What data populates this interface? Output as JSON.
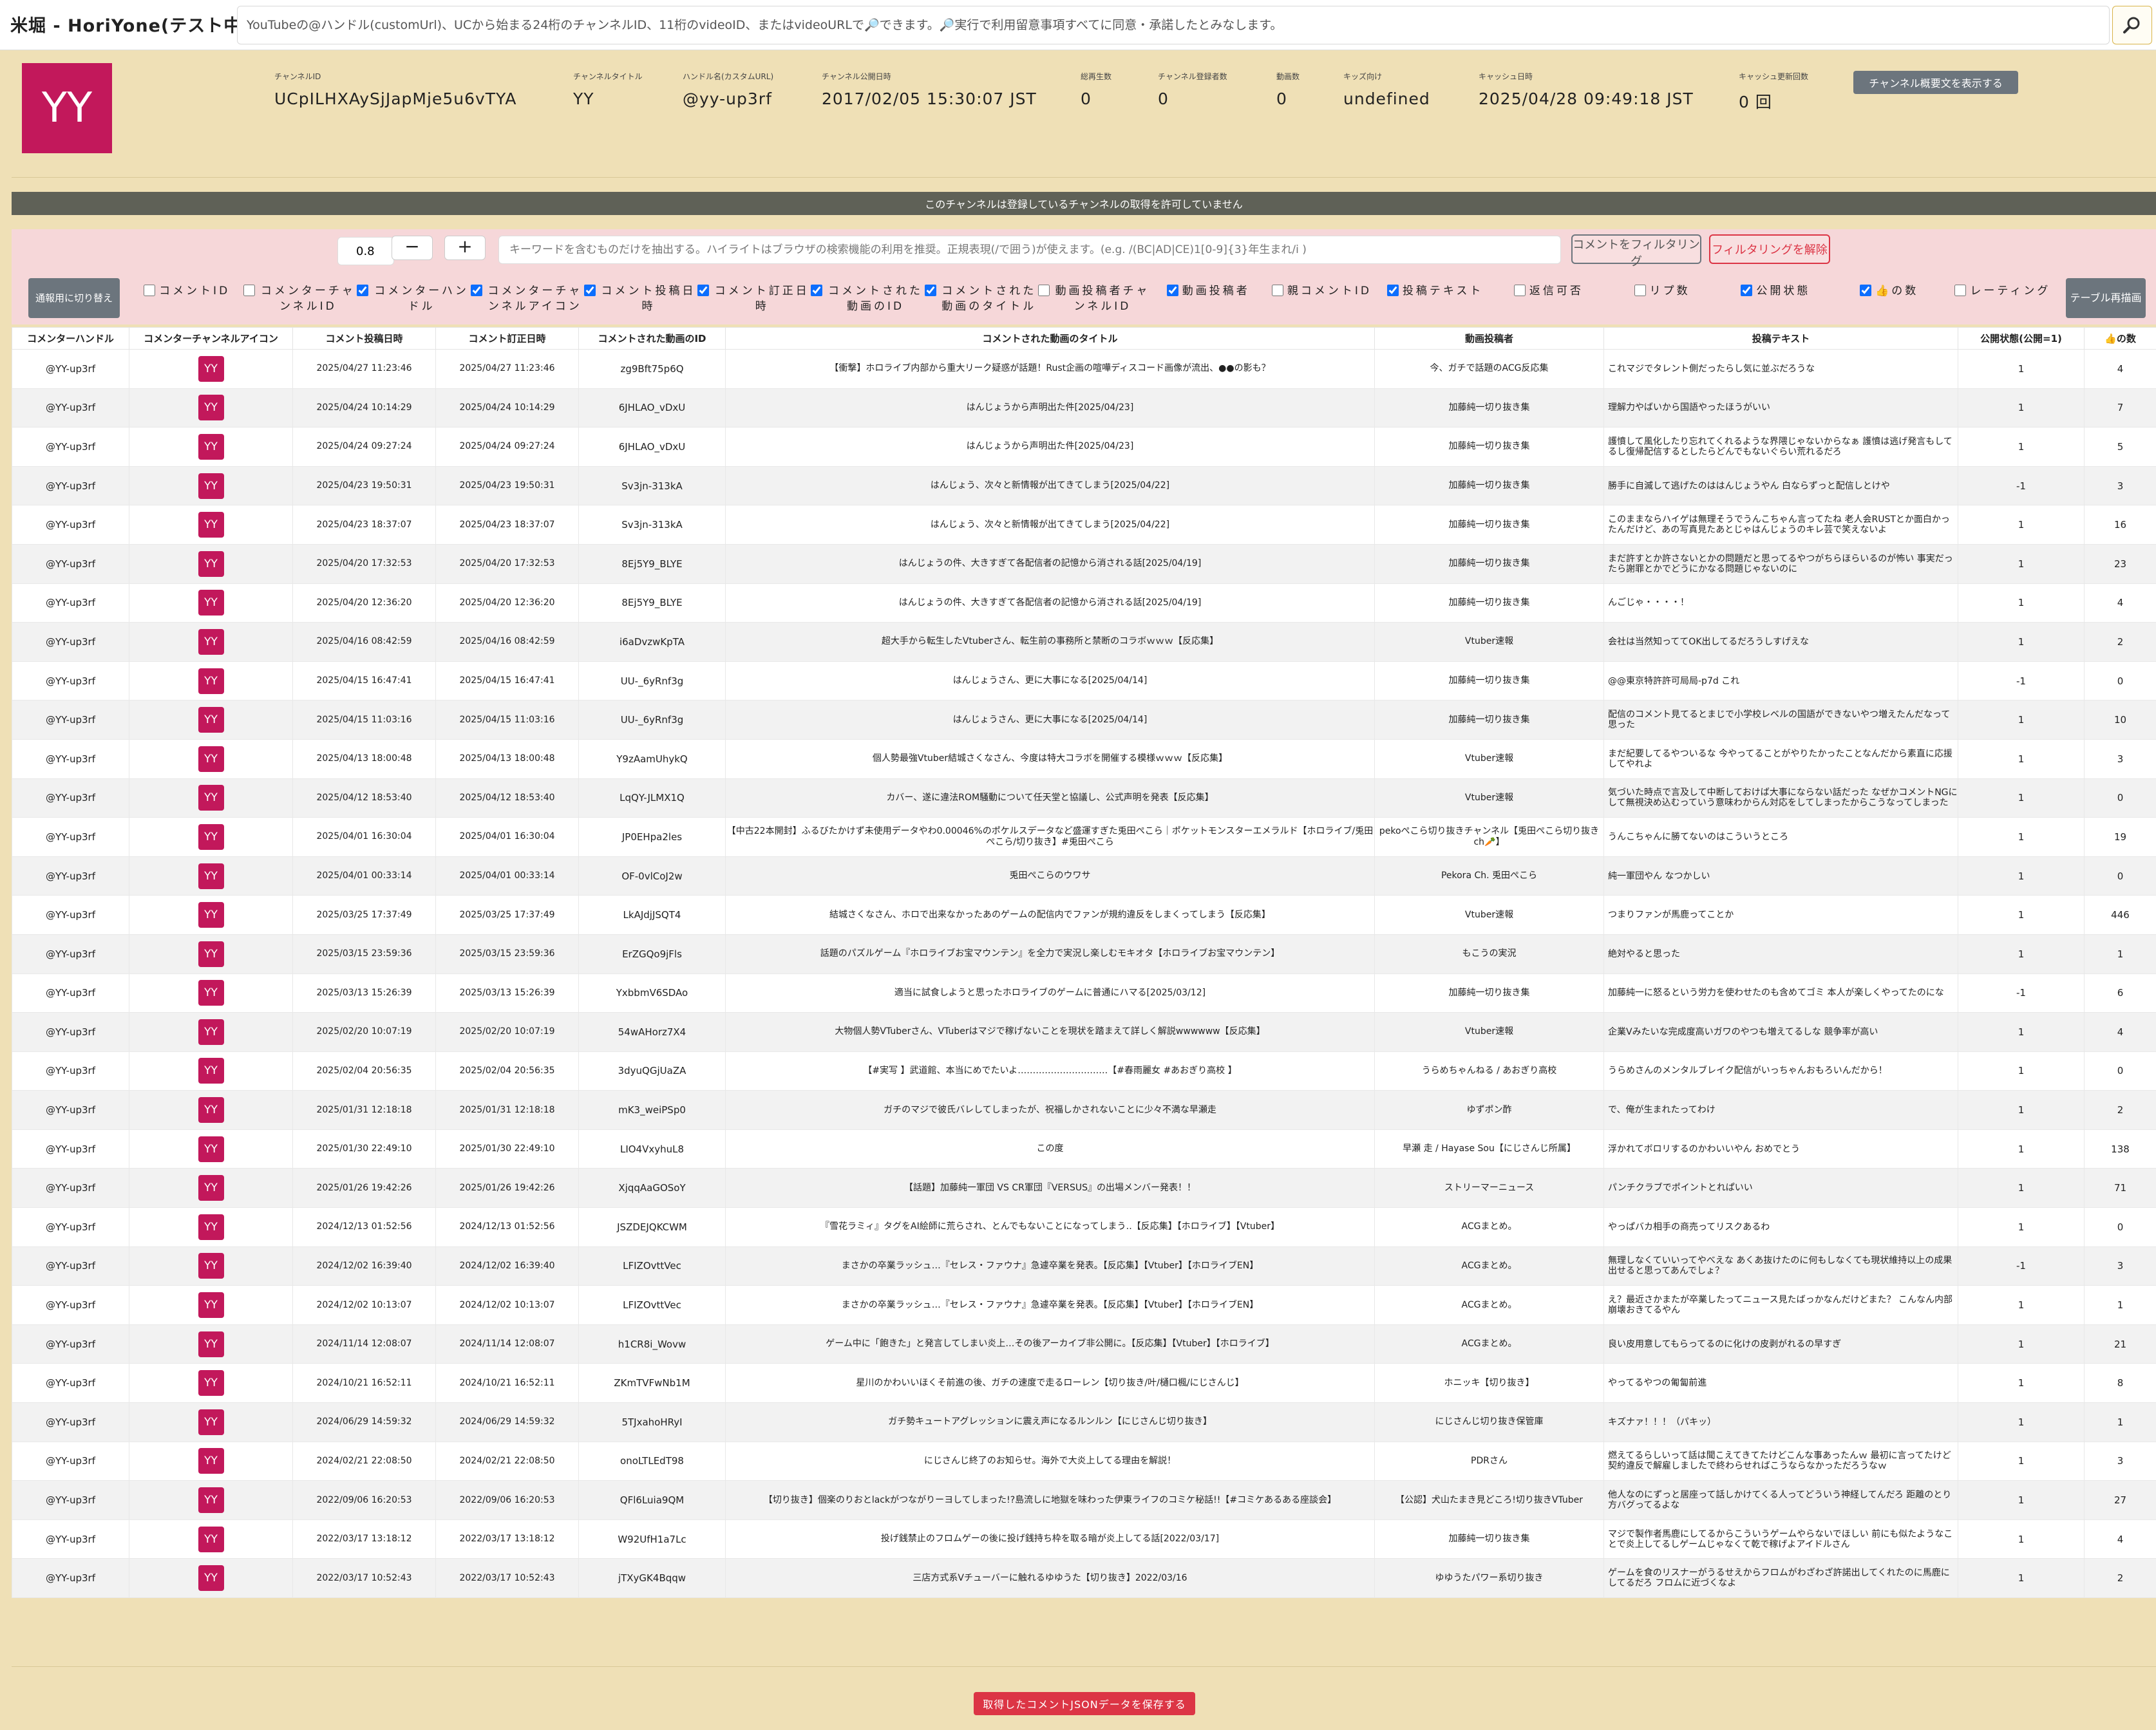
{
  "app": {
    "title": "米堀 - HoriYone(テスト中)"
  },
  "search": {
    "placeholder": "YouTubeの@ハンドル(customUrl)、UCから始まる24桁のチャンネルID、11桁のvideoID、またはvideoURLで🔎できます。🔎実行で利用留意事項すべてに同意・承諾したとみなします。",
    "button_icon": "search-icon"
  },
  "channel": {
    "avatar_text": "YY",
    "avatar_color": "#c2185b",
    "fields": [
      {
        "label": "チャンネルID",
        "value": "UCpILHXAySjJapMje5u6vTYA"
      },
      {
        "label": "チャンネルタイトル",
        "value": "YY"
      },
      {
        "label": "ハンドル名(カスタムURL)",
        "value": "@yy-up3rf"
      },
      {
        "label": "チャンネル公開日時",
        "value": "2017/02/05 15:30:07 JST"
      },
      {
        "label": "総再生数",
        "value": "0"
      },
      {
        "label": "チャンネル登録者数",
        "value": "0"
      },
      {
        "label": "動画数",
        "value": "0"
      },
      {
        "label": "キッズ向け",
        "value": "undefined"
      },
      {
        "label": "キャッシュ日時",
        "value": "2025/04/28 09:49:18 JST"
      },
      {
        "label": "キャッシュ更新回数",
        "value": "0 回"
      }
    ],
    "desc_button": "チャンネル概要文を表示する"
  },
  "notice": "このチャンネルは登録しているチャンネルの取得を許可していません",
  "filter": {
    "threshold": "0.8",
    "minus": "−",
    "plus": "+",
    "keyword_placeholder": "キーワードを含むものだけを抽出する。ハイライトはブラウザの検索機能の利用を推奨。正規表現(/で囲う)が使えます。(e.g. /(BC|AD|CE)1[0-9]{3}年生まれ/i )",
    "apply_button": "コメントをフィルタリング",
    "clear_button": "フィルタリングを解除",
    "mobile_button": "通報用に切り替え",
    "redraw_button": "テーブル再描画"
  },
  "columns": [
    {
      "label": "コメントID",
      "checked": false
    },
    {
      "label": "コメンターチャンネルID",
      "checked": false
    },
    {
      "label": "コメンターハンドル",
      "checked": true
    },
    {
      "label": "コメンターチャンネルアイコン",
      "checked": true
    },
    {
      "label": "コメント投稿日時",
      "checked": true
    },
    {
      "label": "コメント訂正日時",
      "checked": true
    },
    {
      "label": "コメントされた動画のID",
      "checked": true
    },
    {
      "label": "コメントされた動画のタイトル",
      "checked": true
    },
    {
      "label": "動画投稿者チャンネルID",
      "checked": false
    },
    {
      "label": "動画投稿者",
      "checked": true
    },
    {
      "label": "親コメントID",
      "checked": false
    },
    {
      "label": "投稿テキスト",
      "checked": true
    },
    {
      "label": "返信可否",
      "checked": false
    },
    {
      "label": "リプ数",
      "checked": false
    },
    {
      "label": "公開状態",
      "checked": true
    },
    {
      "label": "👍の数",
      "checked": true
    },
    {
      "label": "レーティング",
      "checked": false
    }
  ],
  "table": {
    "headers": [
      "コメンターハンドル",
      "コメンターチャンネルアイコン",
      "コメント投稿日時",
      "コメント訂正日時",
      "コメントされた動画のID",
      "コメントされた動画のタイトル",
      "動画投稿者",
      "投稿テキスト",
      "公開状態(公開=1)",
      "👍の数"
    ],
    "icon_text": "YY",
    "rows": [
      [
        "@YY-up3rf",
        "2025/04/27 11:23:46",
        "2025/04/27 11:23:46",
        "zg9Bft75p6Q",
        "【衝撃】ホロライブ内部から重大リーク疑惑が話題！Rust企画の喧嘩ディスコード画像が流出、●●の影も？",
        "今、ガチで話題のACG反応集",
        "これマジでタレント側だったらし気に並ぶだろうな",
        "1",
        "4"
      ],
      [
        "@YY-up3rf",
        "2025/04/24 10:14:29",
        "2025/04/24 10:14:29",
        "6JHLAO_vDxU",
        "はんじょうから声明出た件[2025/04/23]",
        "加藤純一切り抜き集",
        "理解力やばいから国語やったほうがいい",
        "1",
        "7"
      ],
      [
        "@YY-up3rf",
        "2025/04/24 09:27:24",
        "2025/04/24 09:27:24",
        "6JHLAO_vDxU",
        "はんじょうから声明出た件[2025/04/23]",
        "加藤純一切り抜き集",
        "護憤して風化したり忘れてくれるような界隈じゃないからなぁ 護憤は逃げ発言もしてるし復帰配信するとしたらどんでもないぐらい荒れるだろ",
        "1",
        "5"
      ],
      [
        "@YY-up3rf",
        "2025/04/23 19:50:31",
        "2025/04/23 19:50:31",
        "Sv3jn-313kA",
        "はんじょう、次々と新情報が出てきてしまう[2025/04/22]",
        "加藤純一切り抜き集",
        "勝手に自滅して逃げたのははんじょうやん 白ならずっと配信しとけや",
        "-1",
        "3"
      ],
      [
        "@YY-up3rf",
        "2025/04/23 18:37:07",
        "2025/04/23 18:37:07",
        "Sv3jn-313kA",
        "はんじょう、次々と新情報が出てきてしまう[2025/04/22]",
        "加藤純一切り抜き集",
        "このままならハイゲは無理そうでうんこちゃん言ってたね 老人会RUSTとか面白かったんだけど、あの写真見たあとじゃはんじょうのキレ芸で笑えないよ",
        "1",
        "16"
      ],
      [
        "@YY-up3rf",
        "2025/04/20 17:32:53",
        "2025/04/20 17:32:53",
        "8Ej5Y9_BLYE",
        "はんじょうの件、大きすぎて各配信者の記憶から消される話[2025/04/19]",
        "加藤純一切り抜き集",
        "まだ許すとか許さないとかの問題だと思ってるやつがちらほらいるのが怖い 事実だったら謝罪とかでどうにかなる問題じゃないのに",
        "1",
        "23"
      ],
      [
        "@YY-up3rf",
        "2025/04/20 12:36:20",
        "2025/04/20 12:36:20",
        "8Ej5Y9_BLYE",
        "はんじょうの件、大きすぎて各配信者の記憶から消される話[2025/04/19]",
        "加藤純一切り抜き集",
        "んごじゃ・・・・！",
        "1",
        "4"
      ],
      [
        "@YY-up3rf",
        "2025/04/16 08:42:59",
        "2025/04/16 08:42:59",
        "i6aDvzwKpTA",
        "超大手から転生したVtuberさん、転生前の事務所と禁断のコラボｗｗｗ【反応集】",
        "Vtuber速報",
        "会社は当然知っててOK出してるだろうしすげえな",
        "1",
        "2"
      ],
      [
        "@YY-up3rf",
        "2025/04/15 16:47:41",
        "2025/04/15 16:47:41",
        "UU-_6yRnf3g",
        "はんじょうさん、更に大事になる[2025/04/14]",
        "加藤純一切り抜き集",
        "@@東京特許許可局局-p7d これ",
        "-1",
        "0"
      ],
      [
        "@YY-up3rf",
        "2025/04/15 11:03:16",
        "2025/04/15 11:03:16",
        "UU-_6yRnf3g",
        "はんじょうさん、更に大事になる[2025/04/14]",
        "加藤純一切り抜き集",
        "配信のコメント見てるとまじで小学校レベルの国語ができないやつ増えたんだなって思った",
        "1",
        "10"
      ],
      [
        "@YY-up3rf",
        "2025/04/13 18:00:48",
        "2025/04/13 18:00:48",
        "Y9zAamUhykQ",
        "個人勢最強Vtuber結城さくなさん、今度は特大コラボを開催する模様ｗｗｗ【反応集】",
        "Vtuber速報",
        "まだ紀要してるやついるな 今やってることがやりたかったことなんだから素直に応援してやれよ",
        "1",
        "3"
      ],
      [
        "@YY-up3rf",
        "2025/04/12 18:53:40",
        "2025/04/12 18:53:40",
        "LqQY-JLMX1Q",
        "カバー、遂に違法ROM騒動について任天堂と協議し、公式声明を発表【反応集】",
        "Vtuber速報",
        "気づいた時点で言及して中断しておけば大事にならない話だった なぜかコメントNGにして無視決め込むっていう意味わからん対応をしてしまったからこうなってしまった",
        "1",
        "0"
      ],
      [
        "@YY-up3rf",
        "2025/04/01 16:30:04",
        "2025/04/01 16:30:04",
        "JP0EHpa2les",
        "【中古22本開封】ふるびたかけず未使用データやわ0.00046%のポケルスデータなど盛運すぎた兎田ぺこら｜ポケットモンスターエメラルド【ホロライブ/兎田ぺこら/切り抜き】#兎田ぺこら",
        "pekoぺこら切り抜きチャンネル【兎田ぺこら切り抜きch🥕】",
        "うんこちゃんに勝てないのはこういうところ",
        "1",
        "19"
      ],
      [
        "@YY-up3rf",
        "2025/04/01 00:33:14",
        "2025/04/01 00:33:14",
        "OF-0vlCoJ2w",
        "兎田ぺこらのウワサ",
        "Pekora Ch. 兎田ぺこら",
        "純一軍団やん なつかしい",
        "1",
        "0"
      ],
      [
        "@YY-up3rf",
        "2025/03/25 17:37:49",
        "2025/03/25 17:37:49",
        "LkAJdjJSQT4",
        "結城さくなさん、ホロで出来なかったあのゲームの配信内でファンが規約違反をしまくってしまう【反応集】",
        "Vtuber速報",
        "つまりファンが馬鹿ってことか",
        "1",
        "446"
      ],
      [
        "@YY-up3rf",
        "2025/03/15 23:59:36",
        "2025/03/15 23:59:36",
        "ErZGQo9jFls",
        "話題のパズルゲーム『ホロライブお宝マウンテン』を全力で実況し楽しむモキオタ【ホロライブお宝マウンテン】",
        "もこうの実況",
        "絶対やると思った",
        "1",
        "1"
      ],
      [
        "@YY-up3rf",
        "2025/03/13 15:26:39",
        "2025/03/13 15:26:39",
        "YxbbmV6SDAo",
        "適当に試食しようと思ったホロライブのゲームに普通にハマる[2025/03/12]",
        "加藤純一切り抜き集",
        "加藤純一に怒るという労力を使わせたのも含めてゴミ 本人が楽しくやってたのにな",
        "-1",
        "6"
      ],
      [
        "@YY-up3rf",
        "2025/02/20 10:07:19",
        "2025/02/20 10:07:19",
        "54wAHorz7X4",
        "大物個人勢VTuberさん、VTuberはマジで稼げないことを現状を踏まえて詳しく解説wwwwww【反応集】",
        "Vtuber速報",
        "企業Vみたいな完成度高いガワのやつも増えてるしな 競争率が高い",
        "1",
        "4"
      ],
      [
        "@YY-up3rf",
        "2025/02/04 20:56:35",
        "2025/02/04 20:56:35",
        "3dyuQGjUaZA",
        "【#実写 】武道館、本当にめでたいよ…………………………【#春雨麗女 #あおぎり高校 】",
        "うらめちゃんねる / あおぎり高校",
        "うらめさんのメンタルブレイク配信がいっちゃんおもろいんだから！",
        "1",
        "0"
      ],
      [
        "@YY-up3rf",
        "2025/01/31 12:18:18",
        "2025/01/31 12:18:18",
        "mK3_weiPSp0",
        "ガチのマジで彼氏バレしてしまったが、祝福しかされないことに少々不満な早瀬走",
        "ゆずポン酢",
        "で、俺が生まれたってわけ",
        "1",
        "2"
      ],
      [
        "@YY-up3rf",
        "2025/01/30 22:49:10",
        "2025/01/30 22:49:10",
        "LIO4VxyhuL8",
        "この度",
        "早瀬 走 / Hayase Sou【にじさんじ所属】",
        "浮かれてボロリするのかわいいやん おめでとう",
        "1",
        "138"
      ],
      [
        "@YY-up3rf",
        "2025/01/26 19:42:26",
        "2025/01/26 19:42:26",
        "XjqqAaGOSoY",
        "【話題】加藤純一軍団 VS CR軍団『VERSUS』の出場メンバー発表！！",
        "ストリーマーニュース",
        "パンチクラブでポイントとれぱいい",
        "1",
        "71"
      ],
      [
        "@YY-up3rf",
        "2024/12/13 01:52:56",
        "2024/12/13 01:52:56",
        "JSZDEJQKCWM",
        "『雪花ラミィ』タグをAI絵師に荒らされ、とんでもないことになってしまう‥【反応集】【ホロライブ】【Vtuber】",
        "ACGまとめ。",
        "やっぱバカ相手の商売ってリスクあるわ",
        "1",
        "0"
      ],
      [
        "@YY-up3rf",
        "2024/12/02 16:39:40",
        "2024/12/02 16:39:40",
        "LFIZOvttVec",
        "まさかの卒業ラッシュ…『セレス・ファウナ』急遽卒業を発表。【反応集】【Vtuber】【ホロライブEN】",
        "ACGまとめ。",
        "無理しなくていいってやべえな あくあ抜けたのに何もしなくても現状維持以上の成果出せると思ってあんでしょ？",
        "-1",
        "3"
      ],
      [
        "@YY-up3rf",
        "2024/12/02 10:13:07",
        "2024/12/02 10:13:07",
        "LFIZOvttVec",
        "まさかの卒業ラッシュ…『セレス・ファウナ』急遽卒業を発表。【反応集】【Vtuber】【ホロライブEN】",
        "ACGまとめ。",
        "え？最近さかまたが卒業したってニュース見たばっかなんだけどまた？ こんなん内部崩壊おきてるやん",
        "1",
        "1"
      ],
      [
        "@YY-up3rf",
        "2024/11/14 12:08:07",
        "2024/11/14 12:08:07",
        "h1CR8i_Wovw",
        "ゲーム中に「飽きた」と発言してしまい炎上…その後アーカイブ非公開に。【反応集】【Vtuber】【ホロライブ】",
        "ACGまとめ。",
        "良い皮用意してもらってるのに化けの皮剥がれるの早すぎ",
        "1",
        "21"
      ],
      [
        "@YY-up3rf",
        "2024/10/21 16:52:11",
        "2024/10/21 16:52:11",
        "ZKmTVFwNb1M",
        "星川のかわいいほくそ前進の後、ガチの速度で走るローレン【切り抜き/叶/樋口楓/にじさんじ】",
        "ホニッキ【切り抜き】",
        "やってるやつの匍匐前進",
        "1",
        "8"
      ],
      [
        "@YY-up3rf",
        "2024/06/29 14:59:32",
        "2024/06/29 14:59:32",
        "5TJxahoHRyI",
        "ガチ勢キュートアグレッションに震え声になるルンルン【にじさんじ切り抜き】",
        "にじさんじ切り抜き保管庫",
        "キズナァ！！！（パキッ）",
        "1",
        "1"
      ],
      [
        "@YY-up3rf",
        "2024/02/21 22:08:50",
        "2024/02/21 22:08:50",
        "onoLTLEdT98",
        "にじさんじ終了のお知らせ。海外で大炎上してる理由を解説！",
        "PDRさん",
        "燃えてるらしいって話は聞こえてきてたけどこんな事あったんｗ 最初に言ってたけど契約違反で解雇しましたで終わらせればこうならなかっただろうなｗ",
        "1",
        "3"
      ],
      [
        "@YY-up3rf",
        "2022/09/06 16:20:53",
        "2022/09/06 16:20:53",
        "QFl6Luia9QM",
        "【切り抜き】個楽のりおとlackがつながりーヨしてしまった!?島流しに地獄を味わった伊東ライフのコミケ秘話!!【#コミケあるある座談会】",
        "【公認】犬山たまき見どころ!切り抜きVTuber",
        "他人なのにずっと居座って話しかけてくる人ってどういう神経してんだろ 距離のとり方バグってるよな",
        "1",
        "27"
      ],
      [
        "@YY-up3rf",
        "2022/03/17 13:18:12",
        "2022/03/17 13:18:12",
        "W92UfH1a7Lc",
        "投げ銭禁止のフロムゲーの後に投げ銭持ち枠を取る暗が炎上してる話[2022/03/17]",
        "加藤純一切り抜き集",
        "マジで製作者馬鹿にしてるからこういうゲームやらないでほしい 前にも似たようなことで炎上してるしゲームじゃなくて乾で稼げよアイドルさん",
        "1",
        "4"
      ],
      [
        "@YY-up3rf",
        "2022/03/17 10:52:43",
        "2022/03/17 10:52:43",
        "jTXyGK4Bqqw",
        "三店方式系Vチューバーに触れるゆゆうた【切り抜き】2022/03/16",
        "ゆゆうたパワー系切り抜き",
        "ゲームを食のリスナーがうるせえからフロムがわざわざ許諾出してくれたのに馬鹿にしてるだろ フロムに近づくなよ",
        "1",
        "2"
      ]
    ]
  },
  "save_button": "取得したコメントJSONデータを保存する"
}
